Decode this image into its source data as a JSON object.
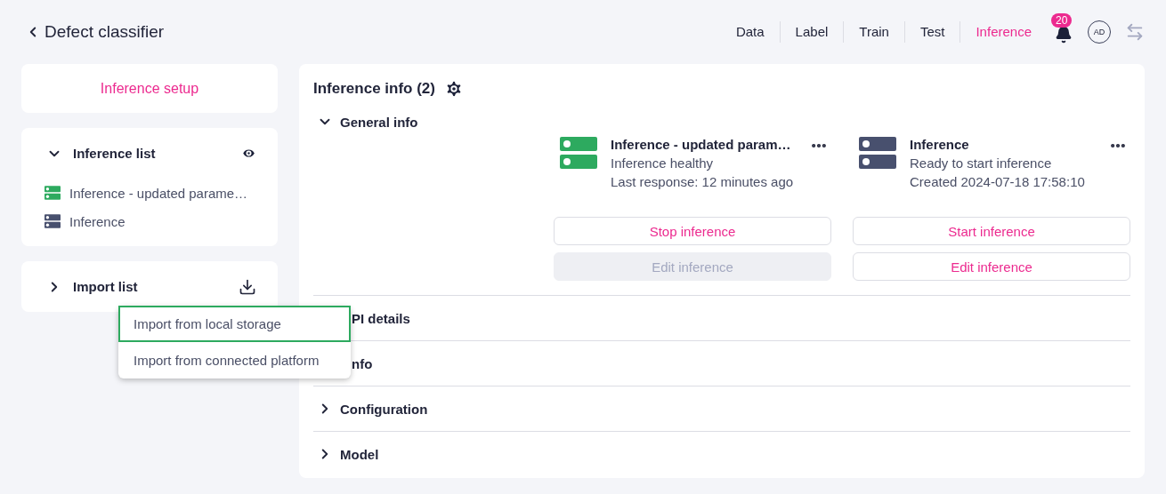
{
  "header": {
    "back_title": "Defect classifier",
    "tabs": [
      {
        "label": "Data",
        "selected": false
      },
      {
        "label": "Label",
        "selected": false
      },
      {
        "label": "Train",
        "selected": false
      },
      {
        "label": "Test",
        "selected": false
      },
      {
        "label": "Inference",
        "selected": true
      }
    ],
    "notifications": "20",
    "avatar": "AD"
  },
  "sidebar": {
    "setup": "Inference setup",
    "inference_list": {
      "title": "Inference list",
      "expanded": true,
      "items": [
        {
          "label": "Inference - updated parame…",
          "color": "#2daa5f"
        },
        {
          "label": "Inference",
          "color": "#48506e"
        }
      ]
    },
    "import_list": {
      "title": "Import list",
      "expanded": false
    },
    "import_menu": [
      {
        "label": "Import from local storage",
        "selected": true
      },
      {
        "label": "Import from connected platform",
        "selected": false
      }
    ]
  },
  "main": {
    "title": "Inference info (2)",
    "sections": [
      {
        "kind": "section",
        "label": "General info",
        "expanded": true,
        "cards": [
          {
            "title": "Inference - updated param…",
            "color": "#2daa5f",
            "lines": [
              "Inference healthy",
              "Last response: 12 minutes ago"
            ],
            "buttons": [
              {
                "label": "Stop inference",
                "disabled": false
              },
              {
                "label": "Edit inference",
                "disabled": true
              }
            ]
          },
          {
            "title": "Inference",
            "color": "#48506e",
            "lines": [
              "Ready to start inference",
              "Created 2024-07-18 17:58:10"
            ],
            "buttons": [
              {
                "label": "Start inference",
                "disabled": false
              },
              {
                "label": "Edit inference",
                "disabled": false
              }
            ]
          }
        ]
      },
      {
        "kind": "covered",
        "label": "PI details"
      },
      {
        "kind": "covered",
        "label": "nfo"
      },
      {
        "kind": "section",
        "label": "Configuration",
        "expanded": false
      },
      {
        "kind": "section",
        "label": "Model",
        "expanded": false
      }
    ]
  }
}
